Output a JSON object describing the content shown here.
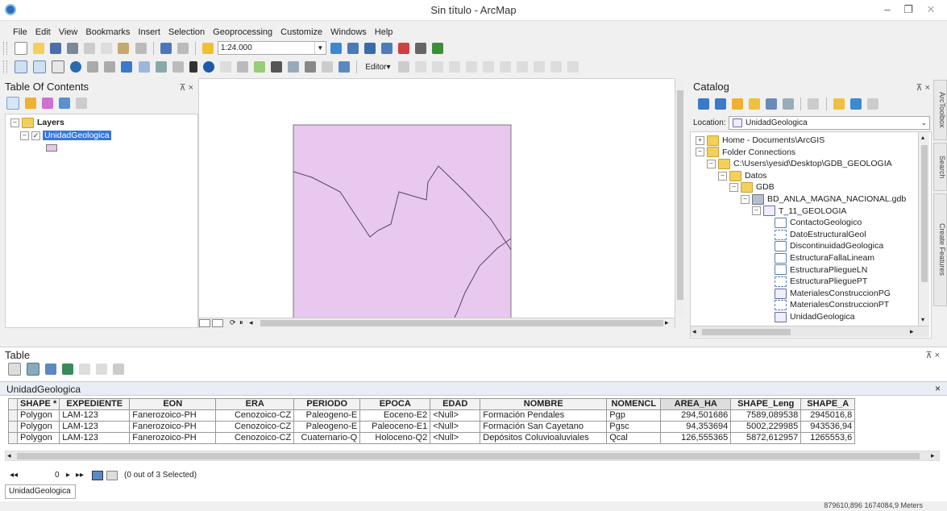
{
  "window": {
    "title": "Sin título - ArcMap",
    "min": "–",
    "max": "❐",
    "close": "✕"
  },
  "menu": [
    "File",
    "Edit",
    "View",
    "Bookmarks",
    "Insert",
    "Selection",
    "Geoprocessing",
    "Customize",
    "Windows",
    "Help"
  ],
  "toolbar": {
    "scale": "1:24.000",
    "editor_label": "Editor▾"
  },
  "toc": {
    "title": "Table Of Contents",
    "pin": "⊼ ×",
    "layers_label": "Layers",
    "layer_name": "UnidadGeologica",
    "layer_fill": "#e6c7ec"
  },
  "map": {
    "fill": "#e8c8ee"
  },
  "catalog": {
    "title": "Catalog",
    "pin": "⊼ ×",
    "location_label": "Location:",
    "location_value": "UnidadGeologica",
    "tree": [
      {
        "label": "Home - Documents\\ArcGIS",
        "icon": "folder",
        "exp": "⊞"
      },
      {
        "label": "Folder Connections",
        "icon": "folder",
        "exp": "⊟"
      },
      {
        "label": "C:\\Users\\yesid\\Desktop\\GDB_GEOLOGIA",
        "icon": "folder",
        "exp": "⊟"
      },
      {
        "label": "Datos",
        "icon": "folder",
        "exp": "⊟"
      },
      {
        "label": "GDB",
        "icon": "folder",
        "exp": "⊟"
      },
      {
        "label": "BD_ANLA_MAGNA_NACIONAL.gdb",
        "icon": "gdb",
        "exp": "⊟"
      },
      {
        "label": "T_11_GEOLOGIA",
        "icon": "dataset",
        "exp": "⊟"
      },
      {
        "label": "ContactoGeologico",
        "icon": "line"
      },
      {
        "label": "DatoEstructuralGeol",
        "icon": "point"
      },
      {
        "label": "DiscontinuidadGeologica",
        "icon": "line"
      },
      {
        "label": "EstructuraFallaLineam",
        "icon": "line"
      },
      {
        "label": "EstructuraPliegueLN",
        "icon": "line"
      },
      {
        "label": "EstructuraPlieguePT",
        "icon": "point"
      },
      {
        "label": "MaterialesConstruccionPG",
        "icon": "poly"
      },
      {
        "label": "MaterialesConstruccionPT",
        "icon": "point"
      },
      {
        "label": "UnidadGeologica",
        "icon": "poly"
      }
    ]
  },
  "side_tabs": [
    "ArcToolbox",
    "Search",
    "Create Features"
  ],
  "table": {
    "title": "Table",
    "pin": "⊼ ×",
    "tab_name": "UnidadGeologica",
    "columns": [
      "SHAPE *",
      "EXPEDIENTE",
      "EON",
      "ERA",
      "PERIODO",
      "EPOCA",
      "EDAD",
      "NOMBRE",
      "NOMENCL",
      "AREA_HA",
      "SHAPE_Leng",
      "SHAPE_A"
    ],
    "rows": [
      [
        "Polygon",
        "LAM-123",
        "Fanerozoico-PH",
        "Cenozoico-CZ",
        "Paleogeno-E",
        "Eoceno-E2",
        "<Null>",
        "Formación Pendales",
        "Pgp",
        "294,501686",
        "7589,089538",
        "2945016,8"
      ],
      [
        "Polygon",
        "LAM-123",
        "Fanerozoico-PH",
        "Cenozoico-CZ",
        "Paleogeno-E",
        "Paleoceno-E1",
        "<Null>",
        "Formación San Cayetano",
        "Pgsc",
        "94,353694",
        "5002,229985",
        "943536,94"
      ],
      [
        "Polygon",
        "LAM-123",
        "Fanerozoico-PH",
        "Cenozoico-CZ",
        "Cuaternario-Q",
        "Holoceno-Q2",
        "<Null>",
        "Depósitos Coluvioaluviales",
        "Qcal",
        "126,555365",
        "5872,612957",
        "1265553,6"
      ]
    ],
    "nav_first": "◂◂",
    "record": "0",
    "nav_next": "▸",
    "nav_last": "▸▸",
    "selection": "(0 out of 3 Selected)",
    "bottom_tab": "UnidadGeologica"
  },
  "status": {
    "coords": "879610,896  1674084,9 Meters"
  }
}
